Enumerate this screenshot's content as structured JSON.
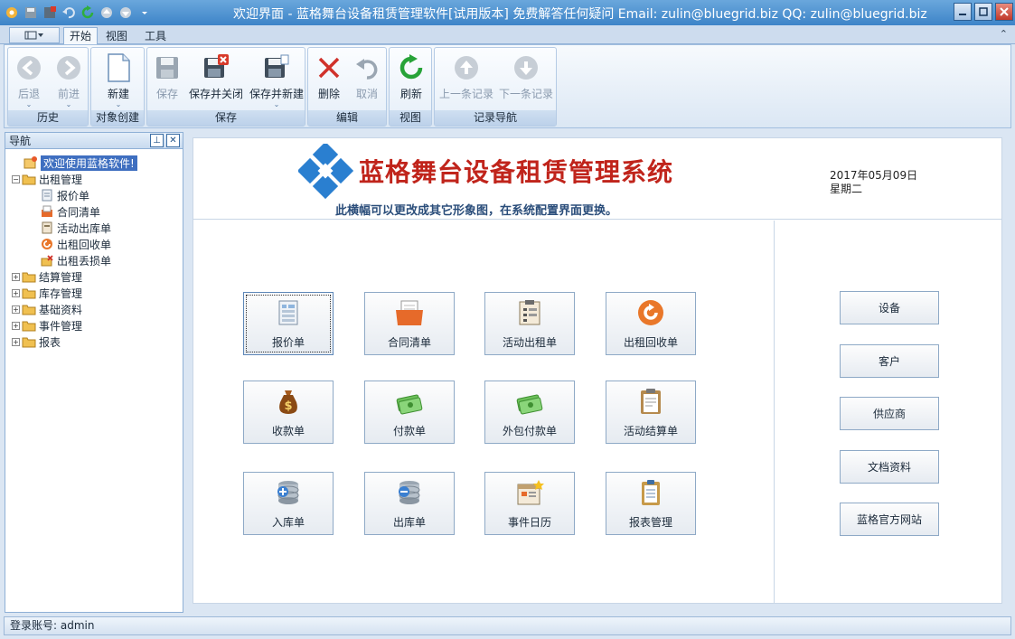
{
  "window": {
    "title": "欢迎界面 - 蓝格舞台设备租赁管理软件[试用版本] 免费解答任何疑问 Email: zulin@bluegrid.biz QQ: zulin@bluegrid.biz"
  },
  "ribbon": {
    "tabs": [
      {
        "label": "开始",
        "active": true
      },
      {
        "label": "视图",
        "active": false
      },
      {
        "label": "工具",
        "active": false
      }
    ],
    "groups": {
      "history": {
        "title": "历史",
        "back": "后退",
        "forward": "前进"
      },
      "create": {
        "title": "对象创建",
        "new": "新建"
      },
      "save": {
        "title": "保存",
        "save": "保存",
        "save_close": "保存并关闭",
        "save_new": "保存并新建"
      },
      "edit": {
        "title": "编辑",
        "delete": "删除",
        "cancel": "取消"
      },
      "view": {
        "title": "视图",
        "refresh": "刷新"
      },
      "records": {
        "title": "记录导航",
        "prev": "上一条记录",
        "next": "下一条记录"
      }
    }
  },
  "nav": {
    "title": "导航",
    "items": {
      "welcome": "欢迎使用蓝格软件!",
      "rental": "出租管理",
      "quote": "报价单",
      "contract": "合同清单",
      "outbound": "活动出库单",
      "return": "出租回收单",
      "loss": "出租丢损单",
      "settle": "结算管理",
      "stock": "库存管理",
      "basic": "基础资料",
      "events": "事件管理",
      "reports": "报表"
    }
  },
  "banner": {
    "title": "蓝格舞台设备租赁管理系统",
    "subtitle": "此横幅可以更改成其它形象图，在系统配置界面更换。",
    "date": "2017年05月09日",
    "weekday": "星期二"
  },
  "tiles": {
    "quote": "报价单",
    "contract": "合同清单",
    "rent_out": "活动出租单",
    "return": "出租回收单",
    "receipt": "收款单",
    "payment": "付款单",
    "outsource": "外包付款单",
    "settlement": "活动结算单",
    "inbound": "入库单",
    "outbound": "出库单",
    "calendar": "事件日历",
    "report": "报表管理"
  },
  "side_buttons": {
    "device": "设备",
    "customer": "客户",
    "supplier": "供应商",
    "docs": "文档资料",
    "website": "蓝格官方网站"
  },
  "status": {
    "login": "登录账号: admin"
  },
  "colors": {
    "title_bar": "#3d84c8",
    "banner_title": "#c0241b",
    "selection": "#3f6fc0"
  }
}
